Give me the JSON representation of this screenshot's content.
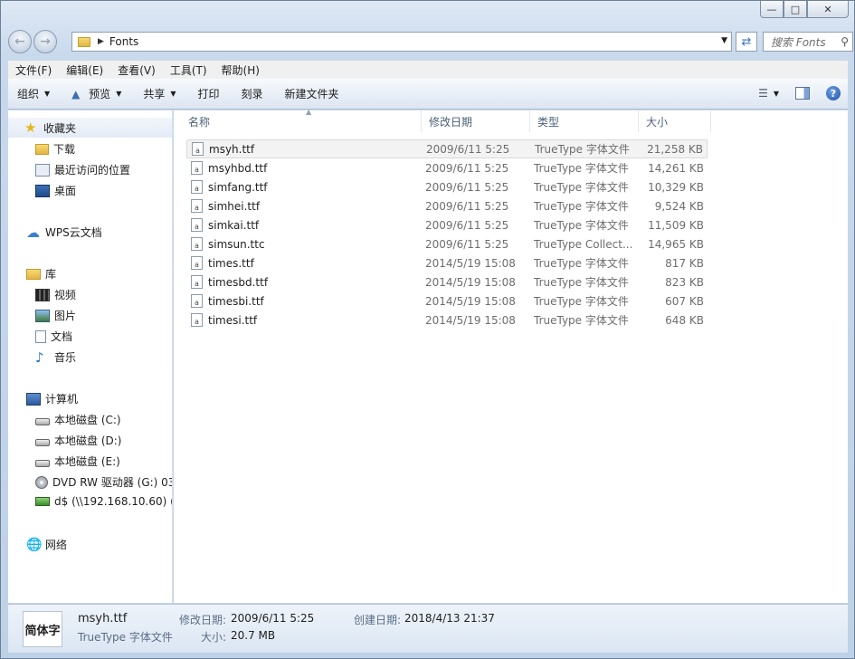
{
  "window": {
    "caption": {
      "minimize": "▭",
      "maximize": "▢",
      "close": "✕"
    }
  },
  "address_bar": {
    "path": "Fonts",
    "search_placeholder": "搜索 Fonts"
  },
  "menu": [
    "文件(F)",
    "编辑(E)",
    "查看(V)",
    "工具(T)",
    "帮助(H)"
  ],
  "toolbar": {
    "organize": "组织",
    "preview": "预览",
    "share": "共享",
    "print": "打印",
    "burn": "刻录",
    "new_folder": "新建文件夹"
  },
  "nav": {
    "favorites": "收藏夹",
    "downloads": "下载",
    "recent": "最近访问的位置",
    "desktop": "桌面",
    "wps": "WPS云文档",
    "libraries": "库",
    "videos": "视频",
    "pictures": "图片",
    "documents": "文档",
    "music": "音乐",
    "computer": "计算机",
    "drive_c": "本地磁盘 (C:)",
    "drive_d": "本地磁盘 (D:)",
    "drive_e": "本地磁盘 (E:)",
    "dvd": "DVD RW 驱动器 (G:) 03",
    "netdrive": "d$ (\\\\192.168.10.60) (Z",
    "network": "网络"
  },
  "columns": {
    "name": "名称",
    "date": "修改日期",
    "type": "类型",
    "size": "大小"
  },
  "files": [
    {
      "name": "msyh.ttf",
      "date": "2009/6/11 5:25",
      "type": "TrueType 字体文件",
      "size": "21,258 KB"
    },
    {
      "name": "msyhbd.ttf",
      "date": "2009/6/11 5:25",
      "type": "TrueType 字体文件",
      "size": "14,261 KB"
    },
    {
      "name": "simfang.ttf",
      "date": "2009/6/11 5:25",
      "type": "TrueType 字体文件",
      "size": "10,329 KB"
    },
    {
      "name": "simhei.ttf",
      "date": "2009/6/11 5:25",
      "type": "TrueType 字体文件",
      "size": "9,524 KB"
    },
    {
      "name": "simkai.ttf",
      "date": "2009/6/11 5:25",
      "type": "TrueType 字体文件",
      "size": "11,509 KB"
    },
    {
      "name": "simsun.ttc",
      "date": "2009/6/11 5:25",
      "type": "TrueType Collect...",
      "size": "14,965 KB"
    },
    {
      "name": "times.ttf",
      "date": "2014/5/19 15:08",
      "type": "TrueType 字体文件",
      "size": "817 KB"
    },
    {
      "name": "timesbd.ttf",
      "date": "2014/5/19 15:08",
      "type": "TrueType 字体文件",
      "size": "823 KB"
    },
    {
      "name": "timesbi.ttf",
      "date": "2014/5/19 15:08",
      "type": "TrueType 字体文件",
      "size": "607 KB"
    },
    {
      "name": "timesi.ttf",
      "date": "2014/5/19 15:08",
      "type": "TrueType 字体文件",
      "size": "648 KB"
    }
  ],
  "details": {
    "thumb_text": "简体字",
    "name": "msyh.ttf",
    "type": "TrueType 字体文件",
    "modified_label": "修改日期:",
    "modified_value": "2009/6/11 5:25",
    "size_label": "大小:",
    "size_value": "20.7 MB",
    "created_label": "创建日期:",
    "created_value": "2018/4/13 21:37"
  }
}
